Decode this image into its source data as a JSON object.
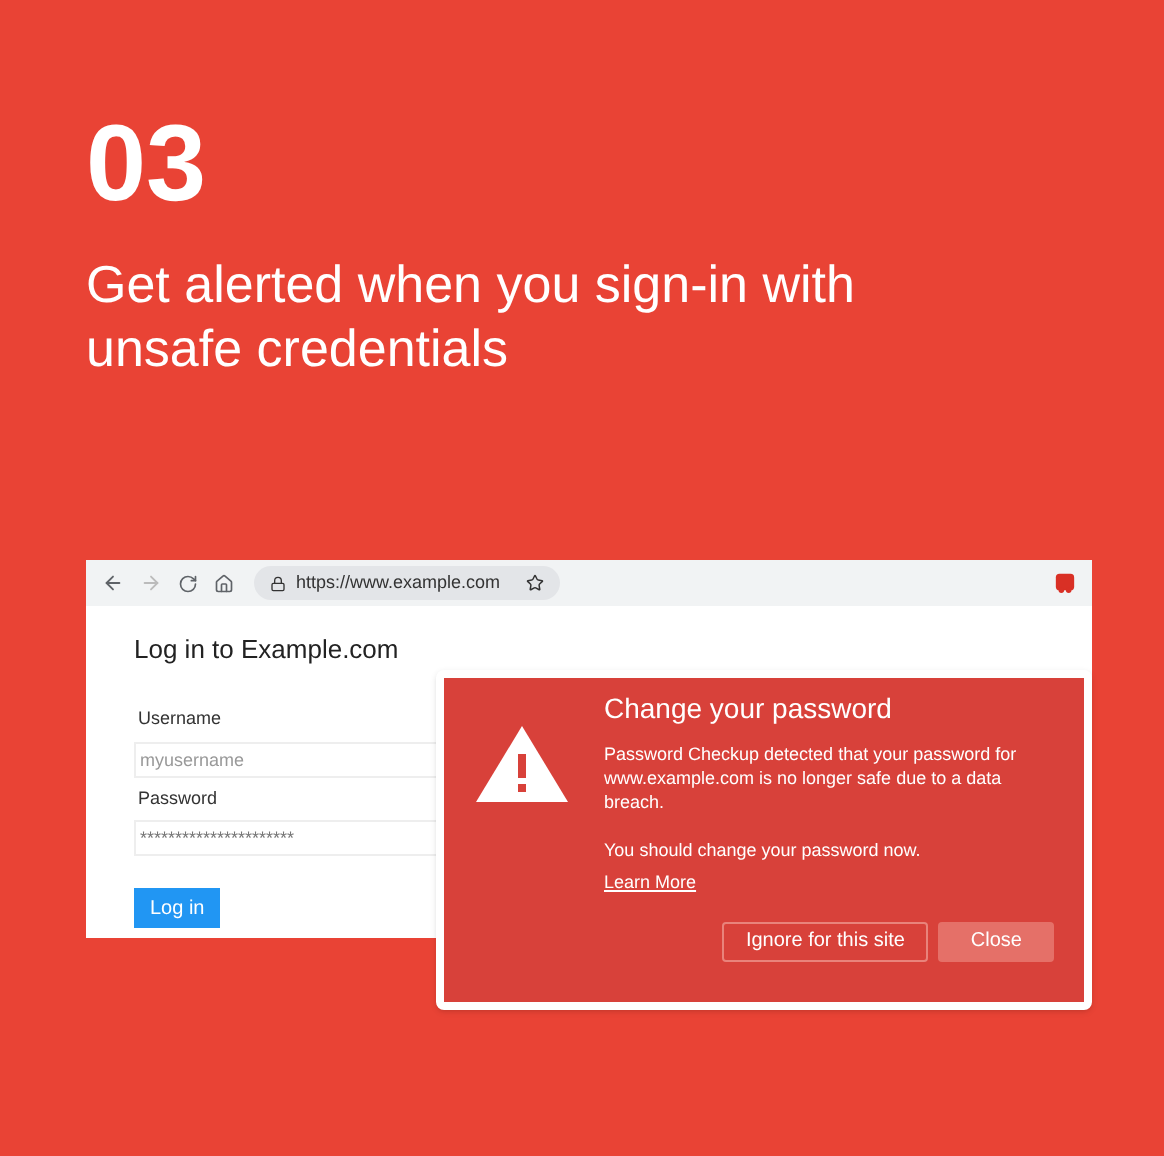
{
  "step_number": "03",
  "headline": "Get alerted when you sign-in with unsafe credentials",
  "browser": {
    "url": "https://www.example.com",
    "bookmarked": false
  },
  "login_page": {
    "title": "Log in to Example.com",
    "fields": [
      {
        "label": "Username",
        "placeholder": "myusername"
      },
      {
        "label": "Password",
        "value": "**********************"
      }
    ],
    "button": "Log in"
  },
  "alert": {
    "title": "Change your password",
    "message": "Password Checkup detected that your password for www.example.com is no longer safe due to a data breach.",
    "advice": "You should change your password now.",
    "link": "Learn More",
    "buttons": [
      {
        "label": "Ignore for this site",
        "kind": "outline"
      },
      {
        "label": "Close",
        "kind": "filled"
      }
    ]
  }
}
